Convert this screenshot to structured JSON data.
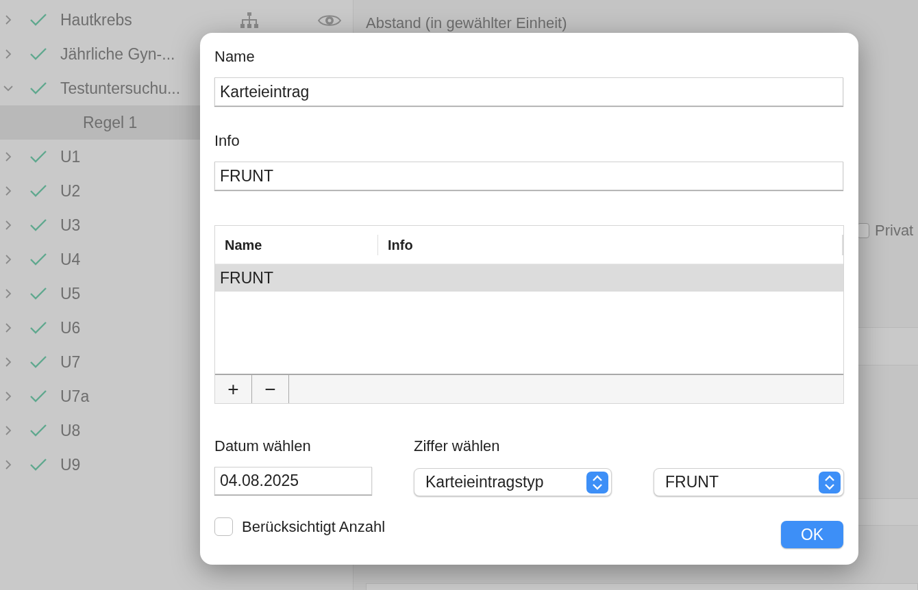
{
  "sidebar": {
    "items": [
      {
        "label": "Hautkrebs",
        "expanded": false,
        "checked": true,
        "selected": false,
        "show_tools": true
      },
      {
        "label": "Jährliche Gyn-...",
        "expanded": false,
        "checked": true,
        "selected": false
      },
      {
        "label": "Testuntersuchu...",
        "expanded": true,
        "checked": true,
        "selected": false,
        "children": [
          {
            "label": "Regel 1",
            "selected": true
          }
        ]
      },
      {
        "label": "U1",
        "expanded": false,
        "checked": true,
        "selected": false
      },
      {
        "label": "U2",
        "expanded": false,
        "checked": true,
        "selected": false
      },
      {
        "label": "U3",
        "expanded": false,
        "checked": true,
        "selected": false
      },
      {
        "label": "U4",
        "expanded": false,
        "checked": true,
        "selected": false
      },
      {
        "label": "U5",
        "expanded": false,
        "checked": true,
        "selected": false
      },
      {
        "label": "U6",
        "expanded": false,
        "checked": true,
        "selected": false
      },
      {
        "label": "U7",
        "expanded": false,
        "checked": true,
        "selected": false
      },
      {
        "label": "U7a",
        "expanded": false,
        "checked": true,
        "selected": false
      },
      {
        "label": "U8",
        "expanded": false,
        "checked": true,
        "selected": false
      },
      {
        "label": "U9",
        "expanded": false,
        "checked": true,
        "selected": false
      }
    ]
  },
  "detail": {
    "distance_label": "Abstand (in gewählter Einheit)",
    "private_label": "Privat",
    "private_checked": false
  },
  "dialog": {
    "name_label": "Name",
    "name_value": "Karteieintrag",
    "info_label": "Info",
    "info_value": "FRUNT",
    "table": {
      "columns": [
        "Name",
        "Info"
      ],
      "rows": [
        {
          "name": "FRUNT",
          "selected": true
        }
      ],
      "add": "+",
      "remove": "−"
    },
    "date_label": "Datum wählen",
    "date_value": "04.08.2025",
    "digit_label": "Ziffer wählen",
    "popups": [
      "Karteieintragstyp",
      "FRUNT"
    ],
    "count_checkbox": {
      "label": "Berücksichtigt Anzahl",
      "checked": false
    },
    "ok": "OK"
  }
}
